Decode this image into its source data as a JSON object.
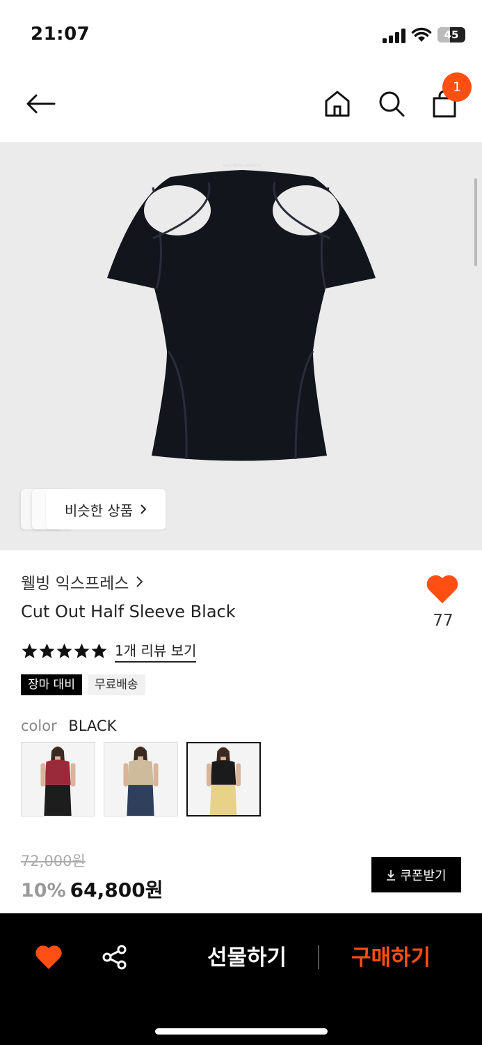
{
  "status_bar": {
    "time": "21:07",
    "battery": "45",
    "battery_level": 0.45
  },
  "header": {
    "cart_count": "1",
    "icons": [
      "arrow-left-icon",
      "home-icon",
      "search-icon",
      "shopping-bag-icon"
    ]
  },
  "hero": {
    "image_text": "WELLBEING EXPRESS",
    "similar_label": "비슷한 상품"
  },
  "product": {
    "brand": "웰빙 익스프레스",
    "title": "Cut Out Half Sleeve Black",
    "like_count": "77",
    "rating": 5,
    "review_link": "1개 리뷰 보기",
    "tags": [
      "장마 대비",
      "무료배송"
    ],
    "color_label": "color",
    "color_value": "BLACK",
    "swatches": [
      {
        "name": "red",
        "top_color": "#9a2a3a",
        "bottom_color": "#1d1d1d",
        "selected": false
      },
      {
        "name": "beige",
        "top_color": "#cdbb9b",
        "bottom_color": "#2f3f5c",
        "selected": false
      },
      {
        "name": "black",
        "top_color": "#1b1b1b",
        "bottom_color": "#e7d287",
        "selected": true
      }
    ],
    "price_original": "72,000원",
    "discount": "10%",
    "price_final": "64,800원",
    "coupon_label": "쿠폰받기"
  },
  "action_bar": {
    "gift_label": "선물하기",
    "buy_label": "구매하기"
  },
  "colors": {
    "accent": "#ff4f12",
    "hero_bg": "#ebebeb",
    "bar_bg": "#000000"
  }
}
